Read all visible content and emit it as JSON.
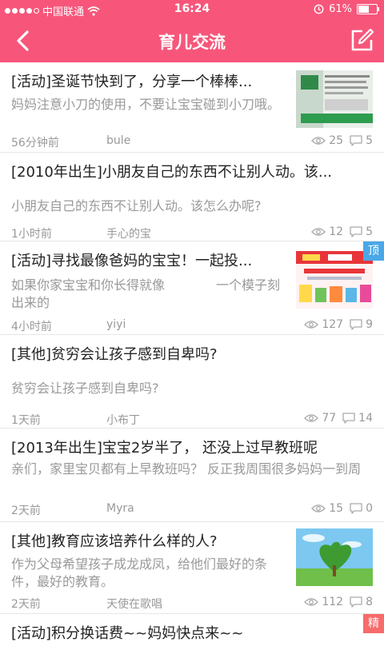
{
  "status": {
    "carrier": "中国联通",
    "time": "16:24",
    "battery": "61%",
    "battery_level": 0.61
  },
  "header": {
    "title": "育儿交流"
  },
  "colors": {
    "brand": "#f7567a",
    "top_badge": "#4aa8e8",
    "hot_badge": "#f76b6b"
  },
  "posts": [
    {
      "title": "[活动]圣诞节快到了，分享一个棒棒...",
      "summary": "妈妈注意小刀的使用，不要让宝宝碰到小刀哦。",
      "time": "56分钟前",
      "author": "bule",
      "views": "25",
      "comments": "5"
    },
    {
      "title": "[2010年出生]小朋友自己的东西不让别人动。该...",
      "summary": "小朋友自己的东西不让别人动。该怎么办呢?",
      "time": "1小时前",
      "author": "手心的宝",
      "views": "12",
      "comments": "5"
    },
    {
      "title": "[活动]寻找最像爸妈的宝宝！一起投...",
      "summary": "如果你家宝宝和你长得就像　　　　一个模子刻出来的",
      "time": "4小时前",
      "author": "yiyi",
      "views": "127",
      "comments": "9",
      "badge": "顶"
    },
    {
      "title": "[其他]贫穷会让孩子感到自卑吗?",
      "summary": "贫穷会让孩子感到自卑吗?",
      "time": "1天前",
      "author": "小布丁",
      "views": "77",
      "comments": "14"
    },
    {
      "title": "[2013年出生]宝宝2岁半了，  还没上过早教班呢",
      "summary": "亲们，家里宝贝都有上早教班吗？ 反正我周围很多妈妈一到周",
      "time": "2天前",
      "author": "Myra",
      "views": "15",
      "comments": "0"
    },
    {
      "title": "[其他]教育应该培养什么样的人?",
      "summary": "作为父母希望孩子成龙成凤，给他们最好的条件，最好的教育。",
      "time": "2天前",
      "author": "天使在歌唱",
      "views": "112",
      "comments": "8"
    },
    {
      "title": "[活动]积分换话费~~妈妈快点来~~",
      "badge": "精"
    }
  ]
}
